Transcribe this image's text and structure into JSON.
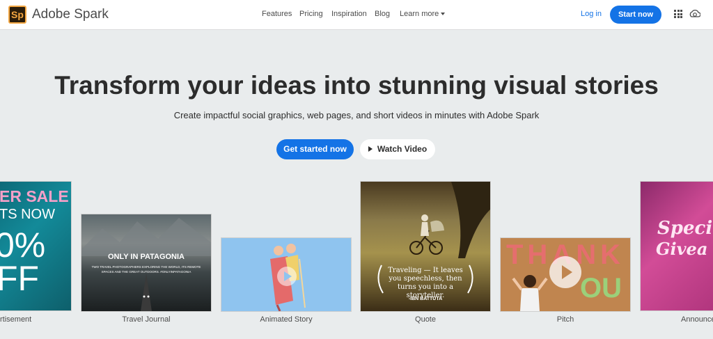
{
  "header": {
    "logo_text": "Sp",
    "brand": "Adobe Spark",
    "nav": [
      "Features",
      "Pricing",
      "Inspiration",
      "Blog",
      "Learn more"
    ],
    "login": "Log in",
    "start_now": "Start now"
  },
  "hero": {
    "title": "Transform your ideas into stunning visual stories",
    "subtitle": "Create impactful social graphics, web pages, and short videos in minutes with Adobe Spark",
    "get_started": "Get started now",
    "watch_video": "Watch Video"
  },
  "cards": [
    {
      "label": "rtisement",
      "text_lines": [
        "ER SALE",
        "TS NOW",
        "0%",
        "FF"
      ]
    },
    {
      "label": "Travel Journal",
      "title": "ONLY IN PATAGONIA",
      "subtitle": "TWO TRAVEL PHOTOGRAPHERS EXPLORING THE WORLD, ITS REMOTE SPACES AND THE GREAT OUTDOORS. #ONLYINPATAGONIA"
    },
    {
      "label": "Animated Story"
    },
    {
      "label": "Quote",
      "quote": "Traveling — It leaves you speechless, then turns you into a storyteller.",
      "author": "-IBN BATTUTA"
    },
    {
      "label": "Pitch",
      "letters_top": "THANK",
      "letters_bottom": "OU"
    },
    {
      "label": "Announce",
      "text_lines": [
        "Speci",
        "Givea"
      ]
    }
  ],
  "colors": {
    "accent": "#1473e6",
    "background": "#e9eced",
    "logo_orange": "#f4a742"
  },
  "icons": [
    "apps-grid-icon",
    "creative-cloud-icon",
    "play-icon",
    "caret-down-icon"
  ]
}
